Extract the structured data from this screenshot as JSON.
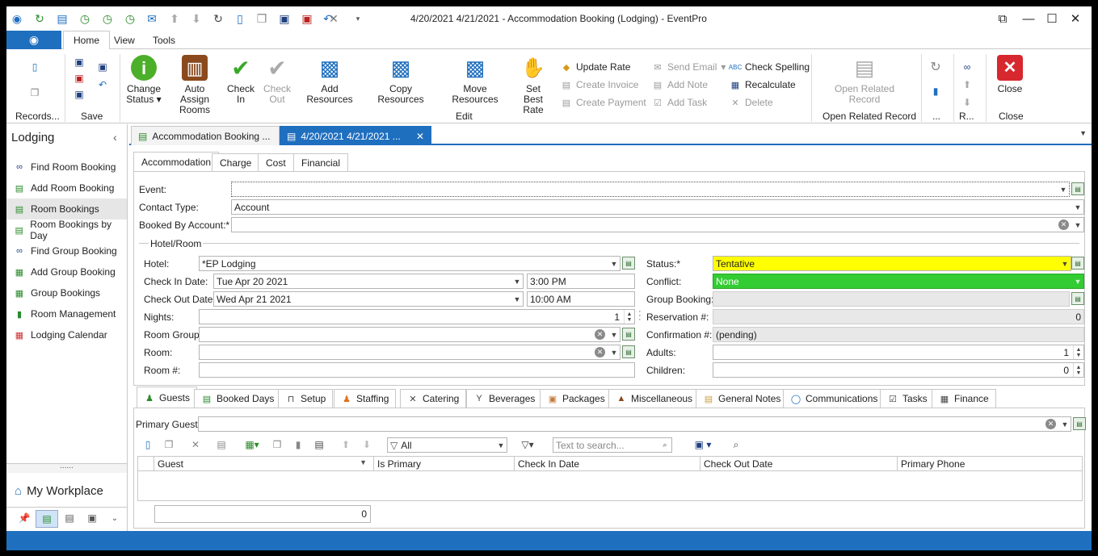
{
  "window": {
    "title": "4/20/2021 4/21/2021  - Accommodation Booking (Lodging) - EventPro",
    "quick_access_icons": [
      "eventpro-logo-icon",
      "refresh-circle-icon",
      "document-icon",
      "clock-icon",
      "clock-icon",
      "clock-icon",
      "mail-icon",
      "arrow-up-circle-icon",
      "arrow-down-circle-icon",
      "refresh-icon",
      "new-doc-icon",
      "copy-icon",
      "save-icon",
      "save-close-icon",
      "undo-icon",
      "close-x-icon",
      "dropdown-icon"
    ]
  },
  "ribbon_tabs": [
    "Home",
    "View",
    "Tools"
  ],
  "ribbon": {
    "records_group": "Records...",
    "save_group": "Save",
    "edit_group": "Edit",
    "open_related_group": "Open Related Record",
    "dots_group": "...",
    "r_group": "R...",
    "close_group": "Close",
    "change_status": "Change Status",
    "auto_assign_rooms": "Auto Assign Rooms",
    "check_in": "Check In",
    "check_out": "Check Out",
    "add_resources": "Add Resources",
    "copy_resources": "Copy Resources",
    "move_resources": "Move Resources",
    "set_best_rate": "Set Best Rate",
    "update_rate": "Update Rate",
    "create_invoice": "Create Invoice",
    "create_payment": "Create Payment",
    "send_email": "Send Email",
    "add_note": "Add Note",
    "add_task": "Add Task",
    "check_spelling": "Check Spelling",
    "recalculate": "Recalculate",
    "delete": "Delete",
    "open_related_record": "Open Related Record",
    "close": "Close"
  },
  "nav": {
    "header": "Lodging",
    "items": [
      {
        "label": "Find Room Booking",
        "icon": "binoculars-icon"
      },
      {
        "label": "Add Room Booking",
        "icon": "add-booking-icon"
      },
      {
        "label": "Room Bookings",
        "icon": "bookings-icon"
      },
      {
        "label": "Room Bookings by Day",
        "icon": "bookings-day-icon"
      },
      {
        "label": "Find Group Booking",
        "icon": "binoculars-icon"
      },
      {
        "label": "Add Group Booking",
        "icon": "add-group-icon"
      },
      {
        "label": "Group Bookings",
        "icon": "group-bookings-icon"
      },
      {
        "label": "Room Management",
        "icon": "room-key-icon"
      },
      {
        "label": "Lodging Calendar",
        "icon": "calendar-icon"
      }
    ],
    "grip": "......",
    "workplace": "My Workplace"
  },
  "doc_tabs": [
    {
      "label": "Accommodation Booking ..."
    },
    {
      "label": "4/20/2021 4/21/2021 ..."
    }
  ],
  "form_tabs": [
    "Accommodation",
    "Charge",
    "Cost",
    "Financial"
  ],
  "form": {
    "event_label": "Event:",
    "event_value": "",
    "contact_type_label": "Contact Type:",
    "contact_type_value": "Account",
    "booked_by_label": "Booked By Account:*",
    "booked_by_value": "",
    "hotel_room_section": "Hotel/Room",
    "hotel_label": "Hotel:",
    "hotel_value": "*EP Lodging",
    "check_in_date_label": "Check In Date:",
    "check_in_date_value": "Tue Apr 20 2021",
    "check_in_time_value": "3:00 PM",
    "check_out_date_label": "Check Out Date:",
    "check_out_date_value": "Wed Apr 21 2021",
    "check_out_time_value": "10:00 AM",
    "nights_label": "Nights:",
    "nights_value": "1",
    "room_group_label": "Room Group:",
    "room_label": "Room:",
    "room_num_label": "Room #:",
    "status_label": "Status:*",
    "status_value": "Tentative",
    "conflict_label": "Conflict:",
    "conflict_value": "None",
    "group_booking_label": "Group Booking:",
    "reservation_label": "Reservation #:",
    "reservation_value": "0",
    "confirmation_label": "Confirmation #:",
    "confirmation_value": "(pending)",
    "adults_label": "Adults:",
    "adults_value": "1",
    "children_label": "Children:",
    "children_value": "0"
  },
  "bottom_tabs": [
    {
      "label": "Guests",
      "icon": "person-icon"
    },
    {
      "label": "Booked Days",
      "icon": "calendar-days-icon"
    },
    {
      "label": "Setup",
      "icon": "table-setup-icon"
    },
    {
      "label": "Staffing",
      "icon": "staff-icon"
    },
    {
      "label": "Catering",
      "icon": "cutlery-icon"
    },
    {
      "label": "Beverages",
      "icon": "glass-icon"
    },
    {
      "label": "Packages",
      "icon": "package-icon"
    },
    {
      "label": "Miscellaneous",
      "icon": "misc-icon"
    },
    {
      "label": "General Notes",
      "icon": "notes-icon"
    },
    {
      "label": "Communications",
      "icon": "speech-bubble-icon"
    },
    {
      "label": "Tasks",
      "icon": "checklist-icon"
    },
    {
      "label": "Finance",
      "icon": "finance-icon"
    }
  ],
  "guests": {
    "primary_guest_label": "Primary Guest:",
    "filter_value": "All",
    "search_placeholder": "Text to search...",
    "columns": [
      "Guest",
      "Is Primary",
      "Check In Date",
      "Check Out Date",
      "Primary Phone"
    ],
    "count": "0"
  },
  "colors": {
    "accent": "#1f6fbf",
    "status_tentative": "#ffff00",
    "conflict_none": "#33cc33"
  }
}
